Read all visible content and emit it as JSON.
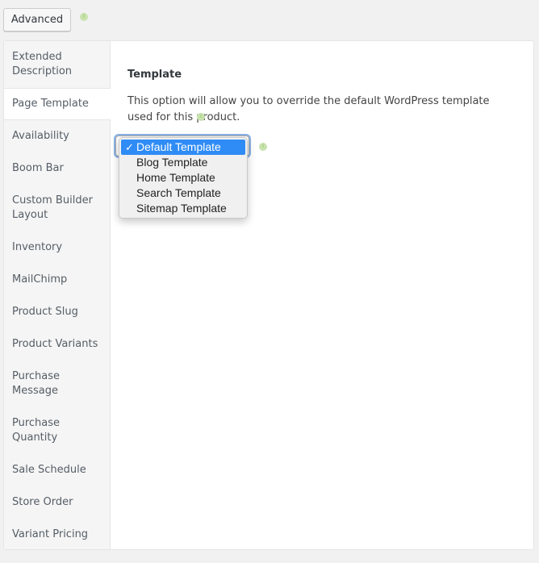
{
  "toolbar": {
    "advanced_label": "Advanced",
    "info_glyph": "i"
  },
  "sidebar": {
    "items": [
      {
        "label": "Extended Description",
        "active": false
      },
      {
        "label": "Page Template",
        "active": true
      },
      {
        "label": "Availability",
        "active": false
      },
      {
        "label": "Boom Bar",
        "active": false
      },
      {
        "label": "Custom Builder Layout",
        "active": false
      },
      {
        "label": "Inventory",
        "active": false
      },
      {
        "label": "MailChimp",
        "active": false
      },
      {
        "label": "Product Slug",
        "active": false
      },
      {
        "label": "Product Variants",
        "active": false
      },
      {
        "label": "Purchase Message",
        "active": false
      },
      {
        "label": "Purchase Quantity",
        "active": false
      },
      {
        "label": "Sale Schedule",
        "active": false
      },
      {
        "label": "Store Order",
        "active": false
      },
      {
        "label": "Variant Pricing",
        "active": false
      }
    ]
  },
  "main": {
    "heading": "Template",
    "description": "This option will allow you to override the default WordPress template used for this product.",
    "select": {
      "selected": "Default Template",
      "check_glyph": "✓",
      "options": [
        "Default Template",
        "Blog Template",
        "Home Template",
        "Search Template",
        "Sitemap Template"
      ]
    }
  },
  "colors": {
    "accent": "#2f8cf6",
    "info": "#c8e2ae"
  }
}
